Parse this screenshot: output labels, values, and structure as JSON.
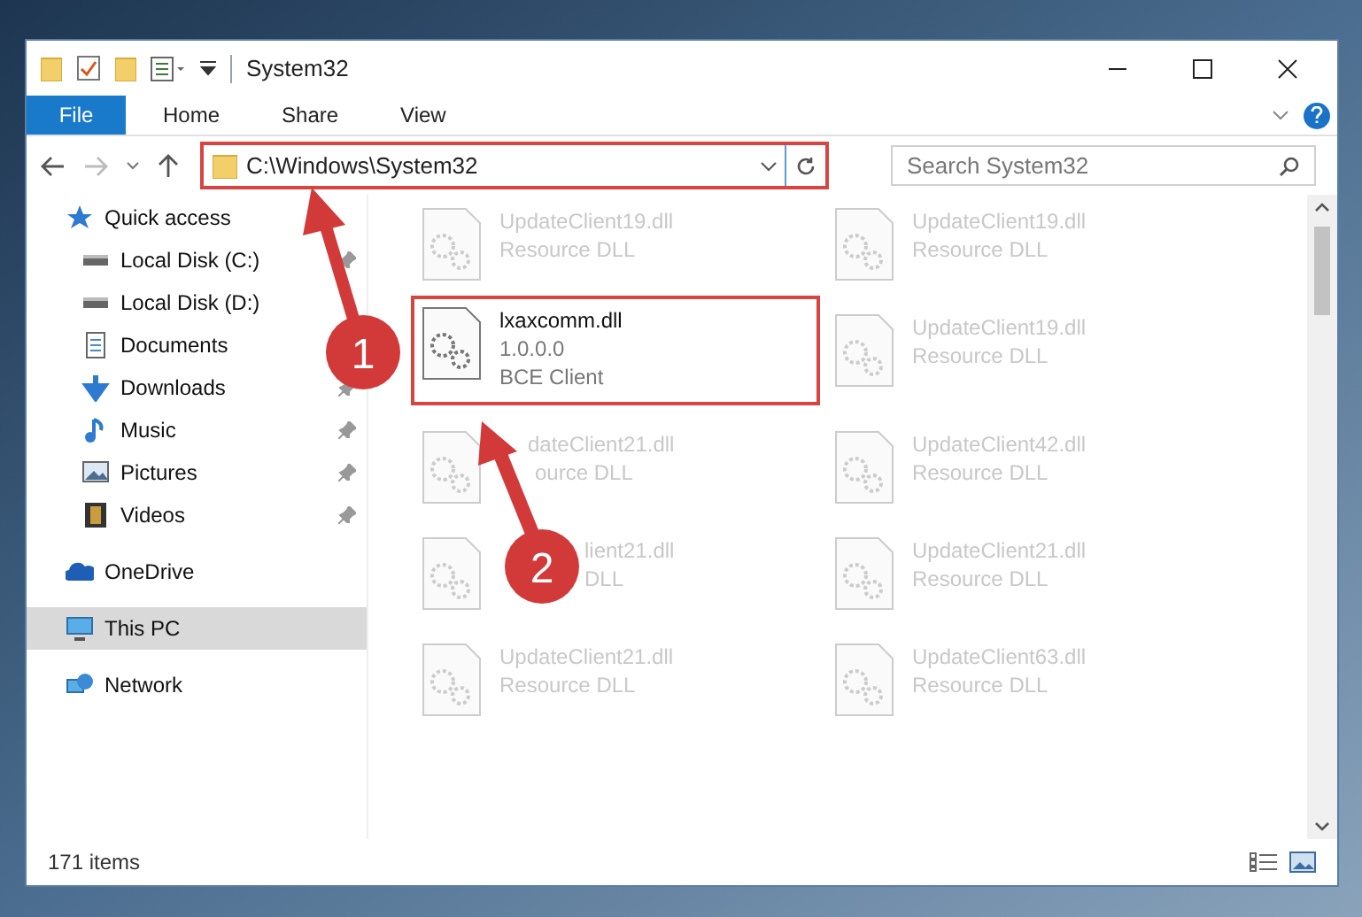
{
  "window": {
    "title": "System32"
  },
  "ribbon": {
    "tabs": [
      {
        "label": "File",
        "selected": true
      },
      {
        "label": "Home",
        "selected": false
      },
      {
        "label": "Share",
        "selected": false
      },
      {
        "label": "View",
        "selected": false
      }
    ]
  },
  "address_bar": {
    "path": "C:\\Windows\\System32",
    "highlighted": true
  },
  "search": {
    "placeholder": "Search System32"
  },
  "sidebar": {
    "items": [
      {
        "label": "Quick access",
        "kind": "star",
        "pinned": false,
        "selected": false
      },
      {
        "label": "Local Disk (C:)",
        "kind": "drive",
        "pinned": true,
        "selected": false
      },
      {
        "label": "Local Disk (D:)",
        "kind": "drive",
        "pinned": false,
        "selected": false
      },
      {
        "label": "Documents",
        "kind": "document",
        "pinned": false,
        "selected": false
      },
      {
        "label": "Downloads",
        "kind": "download",
        "pinned": true,
        "selected": false
      },
      {
        "label": "Music",
        "kind": "music",
        "pinned": true,
        "selected": false
      },
      {
        "label": "Pictures",
        "kind": "picture",
        "pinned": true,
        "selected": false
      },
      {
        "label": "Videos",
        "kind": "video",
        "pinned": true,
        "selected": false
      },
      {
        "label": "OneDrive",
        "kind": "cloud",
        "pinned": false,
        "selected": false
      },
      {
        "label": "This PC",
        "kind": "computer",
        "pinned": false,
        "selected": true
      },
      {
        "label": "Network",
        "kind": "network",
        "pinned": false,
        "selected": false
      }
    ]
  },
  "files": [
    {
      "name": "UpdateClient19.dll",
      "type": "Resource DLL",
      "highlighted": false
    },
    {
      "name": "UpdateClient19.dll",
      "type": "Resource DLL",
      "highlighted": false
    },
    {
      "name": "lxaxcomm.dll",
      "version": "1.0.0.0",
      "type": "BCE Client",
      "highlighted": true
    },
    {
      "name": "UpdateClient19.dll",
      "type": "Resource DLL",
      "highlighted": false
    },
    {
      "name": "dateClient21.dll",
      "type": "ource DLL",
      "highlighted": false,
      "kind": "under_arrow"
    },
    {
      "name": "UpdateClient42.dll",
      "type": "Resource DLL",
      "highlighted": false
    },
    {
      "name": "lient21.dll",
      "type": "DLL",
      "highlighted": false,
      "kind": "under_marker"
    },
    {
      "name": "UpdateClient21.dll",
      "type": "Resource DLL",
      "highlighted": false
    },
    {
      "name": "UpdateClient21.dll",
      "type": "Resource DLL",
      "highlighted": false
    },
    {
      "name": "UpdateClient63.dll",
      "type": "Resource DLL",
      "highlighted": false
    }
  ],
  "annotations": [
    {
      "label": "1"
    },
    {
      "label": "2"
    }
  ],
  "status_bar": {
    "text": "171 items"
  }
}
